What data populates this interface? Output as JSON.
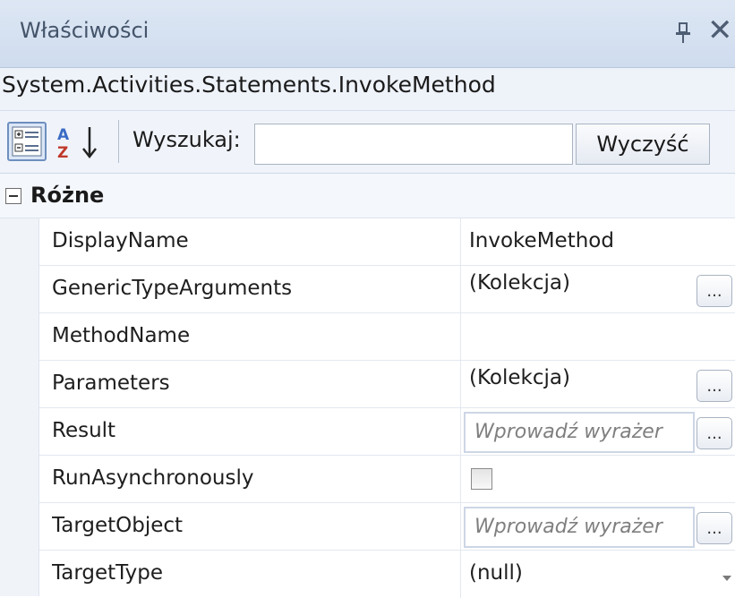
{
  "panel": {
    "title": "Właściwości",
    "pin_icon": "pin-icon",
    "close_label": "✕"
  },
  "object": {
    "type_name": "System.Activities.Statements.InvokeMethod"
  },
  "toolbar": {
    "categorized_icon": "categorized-view-icon",
    "alphabetical_icon": "sort-az-icon",
    "search_label": "Wyszukaj:",
    "search_value": "",
    "clear_label": "Wyczyść"
  },
  "category": {
    "label": "Różne",
    "expanded": true
  },
  "properties": [
    {
      "name": "DisplayName",
      "value": "InvokeMethod",
      "editor": "text"
    },
    {
      "name": "GenericTypeArguments",
      "value": "(Kolekcja)",
      "editor": "collection",
      "button": "..."
    },
    {
      "name": "MethodName",
      "value": "",
      "editor": "text"
    },
    {
      "name": "Parameters",
      "value": "(Kolekcja)",
      "editor": "collection",
      "button": "..."
    },
    {
      "name": "Result",
      "value": "Wprowadź wyrażer",
      "editor": "expression",
      "button": "..."
    },
    {
      "name": "RunAsynchronously",
      "value": "",
      "editor": "checkbox",
      "checked": false
    },
    {
      "name": "TargetObject",
      "value": "Wprowadź wyrażer",
      "editor": "expression",
      "button": "..."
    },
    {
      "name": "TargetType",
      "value": "(null)",
      "editor": "dropdown"
    }
  ],
  "colors": {
    "title_bar": "#dde7f4",
    "toolbar": "#f0f4fa",
    "accent": "#6e8fbf"
  }
}
